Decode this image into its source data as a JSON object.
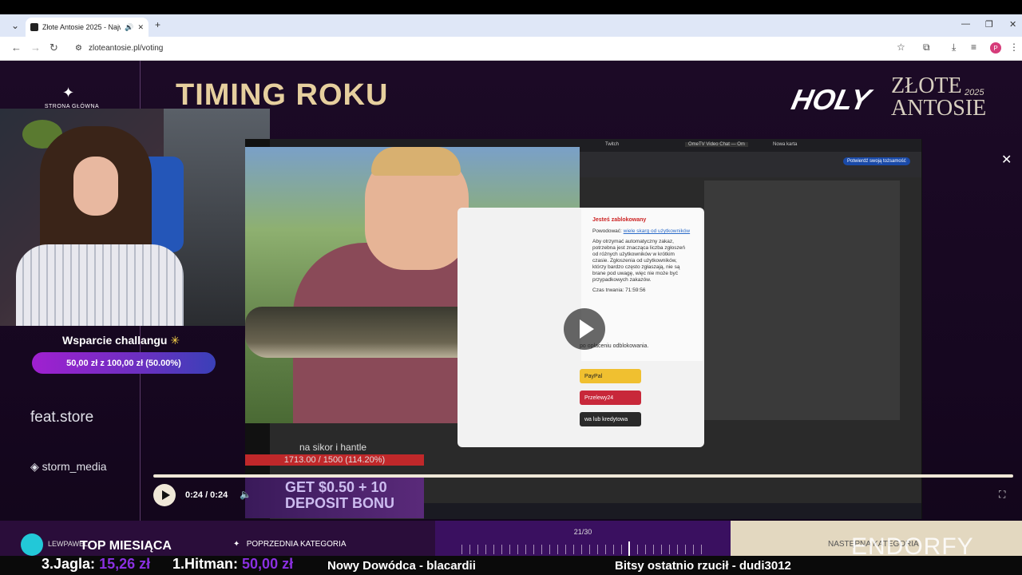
{
  "browser": {
    "tab_title": "Złote Antosie 2025 - Najwi",
    "new_tab": "+",
    "url": "zloteantosie.pl/voting",
    "profile_initial": "P"
  },
  "page": {
    "heading": "TIMING ROKU",
    "home_label": "STRONA GŁÓWNA",
    "logo_holy": "HOLY",
    "logo_line1": "ZŁOTE",
    "logo_line2": "ANTOSIE",
    "logo_year": "2025",
    "sponsors": [
      "feat.store",
      "storm_media"
    ]
  },
  "support": {
    "title": "Wsparcie challangu",
    "progress_text": "50,00 zł z 100,00 zł (50.00%)",
    "progress_fraction": 0.5
  },
  "video": {
    "dialog_title": "Jesteś zablokowany",
    "dialog_reason_label": "Powodować:",
    "dialog_reason_link": "wiele skarg od użytkowników",
    "dialog_body": "Aby otrzymać automatyczny zakaz, potrzebna jest znacząca liczba zgłoszeń od różnych użytkowników w krótkim czasie. Zgłoszenia od użytkowników, którzy bardzo często zgłaszają, nie są brane pod uwagę, więc nie może być przypadkowych zakazów.",
    "dialog_duration": "Czas trwania: 71:59:56",
    "dialog_unlock": "po opłaceniu odblokowania.",
    "pay_options": [
      "PayPal",
      "Przelewy24",
      "wa lub kredytowa"
    ],
    "inner_tabs": [
      "Twitch",
      "OmeTV Video Chat — Om",
      "Nowa karta"
    ],
    "verify": "Potwierdź swoją tożsamość",
    "goal_text": "na sikor i hantle",
    "goal_value": "1713.00 / 1500 (114.20%)",
    "casino_line1": "GET $0.50 + 10",
    "casino_line2": "DEPOSIT BONU",
    "time": "0:24 / 0:24",
    "progress_fraction": 1.0
  },
  "nav": {
    "prev": "POPRZEDNIA KATEGORIA",
    "counter": "21/30",
    "next": "NASTĘPNA KATEGORIA",
    "sponsor": "ENDORFY",
    "user_name": "LEWPAWEL",
    "top_month": "TOP MIESIĄCA"
  },
  "ticker": {
    "item1_name": "3.Jagla:",
    "item1_value": "15,26 zł",
    "item2_name": "1.Hitman:",
    "item2_value": "50,00 zł",
    "item3": "Nowy Dowódca - blacardii",
    "item4": "Bitsy ostatnio rzucił - dudi3012"
  },
  "colors": {
    "heading_gold": "#e6cf9e",
    "page_bg": "#1c0a26",
    "accent_purple": "#8a30e0"
  }
}
